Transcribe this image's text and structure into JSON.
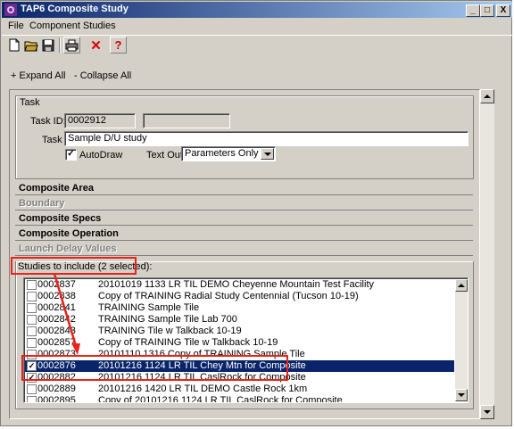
{
  "window": {
    "title": "TAP6 Composite Study",
    "controls": [
      "_",
      "□",
      "X"
    ]
  },
  "menu": {
    "file": "File",
    "component_studies": "Component Studies"
  },
  "toolbar": {
    "icons": [
      "new-document-icon",
      "open-folder-icon",
      "save-disk-icon",
      "print-icon",
      "delete-x-icon",
      "help-question-icon"
    ],
    "help_glyph": "?",
    "delete_glyph": "✕"
  },
  "actions": {
    "expand_all": "+ Expand All",
    "collapse_all": "- Collapse All"
  },
  "task": {
    "group_label": "Task",
    "task_id_label": "Task ID:",
    "task_id_value": "0002912",
    "task_id_extra": "",
    "task_label": "Task",
    "task_value": "Sample D/U study",
    "autodraw_label": "AutoDraw",
    "autodraw_checked": "✓",
    "text_out_label": "Text Out:",
    "text_out_value": "Parameters Only"
  },
  "sections": {
    "composite_area": "Composite Area",
    "boundary": "Boundary",
    "composite_specs": "Composite Specs",
    "composite_operation": "Composite Operation",
    "launch_delay": "Launch Delay Values"
  },
  "studies": {
    "header": "Studies to include (2 selected):",
    "rows": [
      {
        "check": "",
        "id": "0002837",
        "desc": "20101019 1133 LR TIL DEMO Cheyenne Mountain Test Facility"
      },
      {
        "check": "",
        "id": "0002838",
        "desc": "Copy of TRAINING Radial Study Centennial (Tucson 10-19)"
      },
      {
        "check": "",
        "id": "0002841",
        "desc": "TRAINING Sample Tile"
      },
      {
        "check": "",
        "id": "0002842",
        "desc": "TRAINING Sample Tile Lab 700"
      },
      {
        "check": "",
        "id": "0002843",
        "desc": "TRAINING Tile w Talkback 10-19"
      },
      {
        "check": "",
        "id": "0002857",
        "desc": "Copy of TRAINING Tile w Talkback 10-19"
      },
      {
        "check": "",
        "id": "0002873",
        "desc": "20101110 1316 Copy of TRAINING Sample Tile"
      },
      {
        "check": "✓",
        "id": "0002876",
        "desc": "20101216 1124 LR TIL Chey Mtn for Composite"
      },
      {
        "check": "✓",
        "id": "0002882",
        "desc": "20101216 1124 LR TIL CaslRock for Composite"
      },
      {
        "check": "",
        "id": "0002889",
        "desc": "20101216 1420 LR TIL DEMO Castle Rock 1km"
      },
      {
        "check": "",
        "id": "0002895",
        "desc": "Copy of 20101216 1124 LR TIL CaslRock for Composite"
      }
    ]
  },
  "colors": {
    "annotation_red": "#e8231a",
    "selection": "#0a246a",
    "title_start": "#0a246a"
  }
}
